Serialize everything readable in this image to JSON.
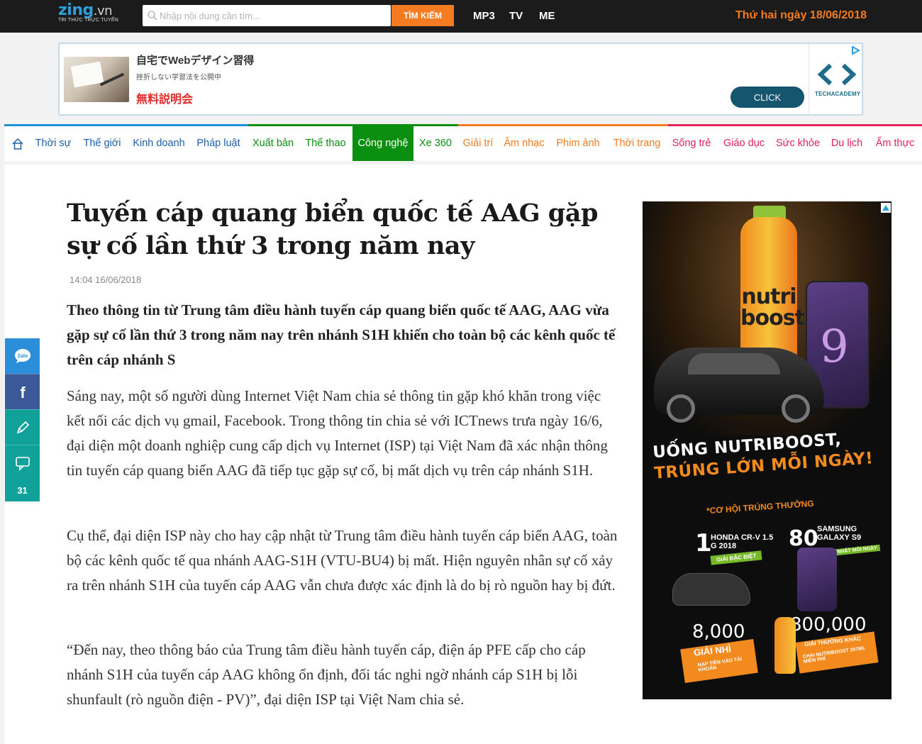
{
  "topbar": {
    "logo_main": "zing",
    "logo_dot": ".vn",
    "logo_tagline": "TRI THỨC TRỰC TUYẾN",
    "search_placeholder": "Nhập nội dung cần tìm...",
    "search_button": "TÌM KIẾM",
    "links": [
      "MP3",
      "TV",
      "ME"
    ],
    "date": "Thứ hai ngày 18/06/2018"
  },
  "banner_ad": {
    "title": "自宅でWebデザイン習得",
    "subtitle": "挫折しない学習法を公開中",
    "red_text": "無料説明会",
    "click_label": "CLICK",
    "brand": "TECHACADEMY"
  },
  "nav": {
    "items": [
      {
        "label": "Thời sự",
        "color": "#1e5fa8"
      },
      {
        "label": "Thế giới",
        "color": "#1e5fa8"
      },
      {
        "label": "Kinh doanh",
        "color": "#1e5fa8"
      },
      {
        "label": "Pháp luật",
        "color": "#1e5fa8"
      },
      {
        "label": "Xuất bản",
        "color": "#0a8f10"
      },
      {
        "label": "Thể thao",
        "color": "#0a8f10"
      },
      {
        "label": "Công nghệ",
        "color": "#ffffff",
        "active": true
      },
      {
        "label": "Xe 360",
        "color": "#0a8f10"
      },
      {
        "label": "Giải trí",
        "color": "#f47b20"
      },
      {
        "label": "Âm nhạc",
        "color": "#f47b20"
      },
      {
        "label": "Phim ảnh",
        "color": "#f47b20"
      },
      {
        "label": "Thời trang",
        "color": "#f47b20"
      },
      {
        "label": "Sống trẻ",
        "color": "#e0245e"
      },
      {
        "label": "Giáo dục",
        "color": "#e0245e"
      },
      {
        "label": "Sức khỏe",
        "color": "#e0245e"
      },
      {
        "label": "Du lịch",
        "color": "#e0245e"
      },
      {
        "label": "Ẩm thực",
        "color": "#e0245e"
      }
    ]
  },
  "article": {
    "title": "Tuyến cáp quang biển quốc tế AAG gặp sự cố lần thứ 3 trong năm nay",
    "timestamp": "14:04 16/06/2018",
    "sapo": "Theo thông tin từ Trung tâm điều hành tuyến cáp quang biển quốc tế AAG, AAG vừa gặp sự cố lần thứ 3 trong năm nay trên nhánh S1H khiến cho toàn bộ các kênh quốc tế trên cáp nhánh S",
    "paragraphs": [
      "Sáng nay, một số người dùng Internet Việt Nam chia sẻ thông tin gặp khó khăn trong việc kết nối các dịch vụ gmail, Facebook. Trong thông tin chia sẻ với ICTnews trưa ngày 16/6, đại diện một doanh nghiệp cung cấp dịch vụ Internet (ISP) tại Việt Nam đã xác nhận thông tin tuyến cáp quang biển AAG đã tiếp tục gặp sự cố, bị mất dịch vụ trên cáp nhánh S1H.",
      "Cụ thể, đại diện ISP này cho hay cập nhật từ Trung tâm điều hành tuyến cáp biển AAG, toàn bộ các kênh quốc tế qua nhánh AAG-S1H (VTU-BU4) bị mất. Hiện nguyên nhân sự cố xảy ra trên nhánh S1H của tuyến cáp AAG vẫn chưa được xác định là do bị rò nguồn hay bị đứt.",
      "“Đến nay, theo thông báo của Trung tâm điều hành tuyến cáp, điện áp PFE cấp cho cáp nhánh S1H của tuyến cáp AAG không ổn định, đối tác nghi ngờ nhánh cáp S1H bị lỗi shunfault (rò nguồn điện - PV)”, đại diện ISP tại Việt Nam chia sẻ."
    ]
  },
  "sharebar": {
    "zalo_label": "Zalo",
    "facebook_label": "f",
    "comment_count": "31"
  },
  "side_ad": {
    "bottle_text": "nutri boost",
    "phone_text": "9",
    "slogan_line1": "UỐNG NUTRIBOOST,",
    "slogan_line2": "TRÚNG LỚN MỖI NGÀY!",
    "chance_text": "*CƠ HỘI TRÚNG THƯỞNG",
    "prize1_num": "1",
    "prize1_text": "HONDA CR-V 1.5 G 2018",
    "prize1_tag": "GIẢI ĐẶC BIỆT",
    "prize2_num": "80",
    "prize2_text": "SAMSUNG GALAXY S9",
    "prize2_tag": "GIẢI NHẤT MỖI NGÀY",
    "prize3_num": "8,000",
    "prize3_tag": "GIẢI NHÌ",
    "prize3_sub": "NẠP TIỀN VÀO TÀI KHOẢN",
    "prize4_num": "800,000",
    "prize4_tag": "GIẢI THƯỞNG KHÁC",
    "prize4_sub": "CHAI NUTRIBOOST 297ML MIỄN PHÍ"
  }
}
